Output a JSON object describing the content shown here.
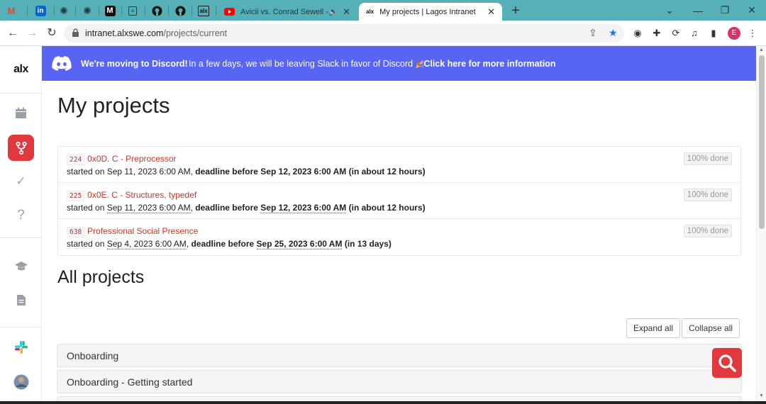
{
  "browser": {
    "pinned_tabs": [
      {
        "icon": "gmail-icon",
        "glyph": "M",
        "color": "#ea4335",
        "bg": "#ffffff"
      },
      {
        "icon": "linkedin-icon",
        "glyph": "in",
        "color": "#ffffff",
        "bg": "#0a66c2"
      },
      {
        "icon": "chatgpt-icon",
        "glyph": "✺",
        "color": "#1f3a3c",
        "bg": "transparent"
      },
      {
        "icon": "chatgpt-icon",
        "glyph": "✺",
        "color": "#1f3a3c",
        "bg": "transparent"
      },
      {
        "icon": "medium-icon",
        "glyph": "M",
        "color": "#ffffff",
        "bg": "#111111"
      },
      {
        "icon": "document-icon",
        "glyph": "🗎",
        "color": "#1f3a3c",
        "bg": "transparent"
      },
      {
        "icon": "github-icon",
        "glyph": "●",
        "color": "#111111",
        "bg": "transparent"
      },
      {
        "icon": "github-icon",
        "glyph": "●",
        "color": "#111111",
        "bg": "transparent"
      },
      {
        "icon": "alx-icon",
        "glyph": "alx",
        "color": "#111111",
        "bg": "transparent"
      }
    ],
    "tabs": [
      {
        "title": "Avicii vs. Conrad Sewell - Tast",
        "icon": "youtube-icon",
        "muted_icon": "speaker-icon"
      },
      {
        "title": "My projects | Lagos Intranet",
        "icon": "alx-icon",
        "favicon_text": "alx"
      }
    ],
    "url_host": "intranet.alxswe.com",
    "url_path": "/projects/current",
    "profile_initial": "E"
  },
  "rail": {
    "logo": "alx",
    "items": [
      {
        "name": "calendar-icon",
        "glyph": "▦",
        "active": false
      },
      {
        "name": "projects-icon",
        "glyph": "⑂",
        "active": true
      },
      {
        "name": "check-icon",
        "glyph": "✓",
        "active": false
      },
      {
        "name": "help-icon",
        "glyph": "?",
        "active": false
      },
      {
        "name": "graduation-cap-icon",
        "glyph": "🎓",
        "active": false
      },
      {
        "name": "document-icon",
        "glyph": "▤",
        "active": false
      },
      {
        "name": "slack-icon",
        "glyph": "✱",
        "active": false
      },
      {
        "name": "avatar",
        "glyph": "",
        "active": false
      }
    ]
  },
  "banner": {
    "title": "We're moving to Discord!",
    "message": "In a few days, we will be leaving Slack in favor of Discord",
    "link": "Click here for more information",
    "color": "#5865f2"
  },
  "page": {
    "title": "My projects",
    "all_title": "All projects",
    "expand_all": "Expand all",
    "collapse_all": "Collapse all"
  },
  "projects": [
    {
      "id": "224",
      "name": "0x0D. C - Preprocessor",
      "started_label": "started on",
      "started": "Sep 11, 2023 6:00 AM",
      "deadline_label": "deadline before",
      "deadline": "Sep 12, 2023 6:00 AM",
      "remaining": "(in about 12 hours)",
      "status": "100% done"
    },
    {
      "id": "225",
      "name": "0x0E. C - Structures, typedef",
      "started_label": "started on",
      "started": "Sep 11, 2023 6:00 AM",
      "deadline_label": "deadline before",
      "deadline": "Sep 12, 2023 6:00 AM",
      "remaining": "(in about 12 hours)",
      "status": "100% done"
    },
    {
      "id": "638",
      "name": "Professional Social Presence",
      "started_label": "started on",
      "started": "Sep 4, 2023 6:00 AM",
      "deadline_label": "deadline before",
      "deadline": "Sep 25, 2023 6:00 AM",
      "remaining": "(in 13 days)",
      "status": "100% done"
    }
  ],
  "sections": [
    {
      "label": "Onboarding"
    },
    {
      "label": "Onboarding - Getting started"
    }
  ],
  "colors": {
    "tab_strip": "#55b0b8",
    "accent_red": "#e0383d",
    "project_link": "#c0392b"
  }
}
